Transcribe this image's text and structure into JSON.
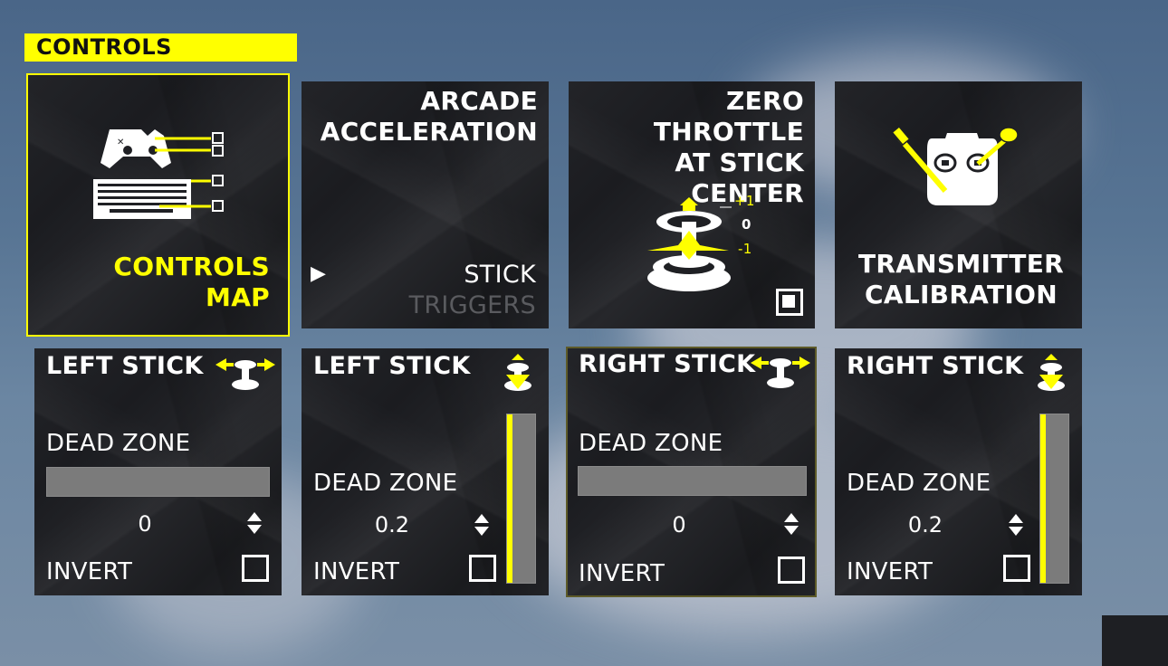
{
  "header": {
    "title": "CONTROLS"
  },
  "tiles": {
    "controls_map": {
      "line1": "CONTROLS",
      "line2": "MAP"
    },
    "arcade": {
      "line1": "ARCADE",
      "line2": "ACCELERATION",
      "option1": "STICK",
      "option2": "TRIGGERS"
    },
    "zero_throttle": {
      "line1": "ZERO THROTTLE",
      "line2": "AT STICK CENTER",
      "plus": "+1",
      "zero": "0",
      "minus": "-1",
      "checked": true
    },
    "transmitter": {
      "line1": "TRANSMITTER",
      "line2": "CALIBRATION"
    }
  },
  "sticks": [
    {
      "title": "LEFT STICK",
      "axis": "horizontal",
      "dead_zone_label": "DEAD ZONE",
      "value": "0",
      "invert_label": "INVERT",
      "invert": false
    },
    {
      "title": "LEFT STICK",
      "axis": "vertical",
      "dead_zone_label": "DEAD ZONE",
      "value": "0.2",
      "invert_label": "INVERT",
      "invert": false
    },
    {
      "title": "RIGHT STICK",
      "axis": "horizontal",
      "dead_zone_label": "DEAD ZONE",
      "value": "0",
      "invert_label": "INVERT",
      "invert": false
    },
    {
      "title": "RIGHT STICK",
      "axis": "vertical",
      "dead_zone_label": "DEAD ZONE",
      "value": "0.2",
      "invert_label": "INVERT",
      "invert": false
    }
  ],
  "colors": {
    "accent": "#ffff00",
    "tile": "#1f2024",
    "bar": "#7b7b7b"
  }
}
